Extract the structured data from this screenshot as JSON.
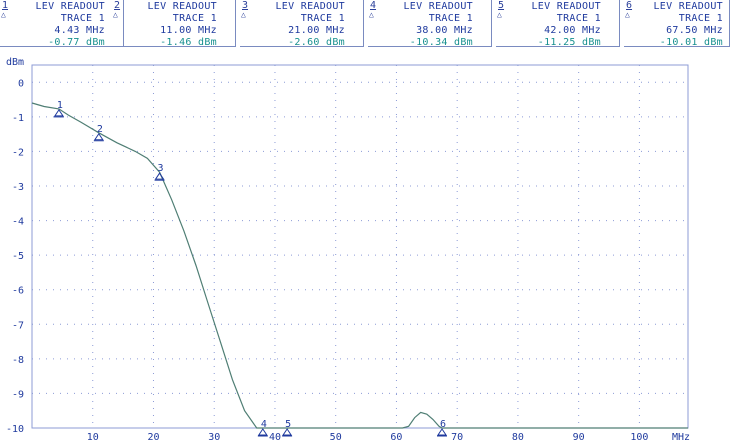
{
  "readouts": [
    {
      "num": "1",
      "title": "LEV READOUT",
      "trace": "TRACE 1",
      "freq": "4.43 MHz",
      "level": "-0.77 dBm"
    },
    {
      "num": "2",
      "title": "LEV READOUT",
      "trace": "TRACE 1",
      "freq": "11.00 MHz",
      "level": "-1.46 dBm"
    },
    {
      "num": "3",
      "title": "LEV READOUT",
      "trace": "TRACE 1",
      "freq": "21.00 MHz",
      "level": "-2.60 dBm"
    },
    {
      "num": "4",
      "title": "LEV READOUT",
      "trace": "TRACE 1",
      "freq": "38.00 MHz",
      "level": "-10.34 dBm"
    },
    {
      "num": "5",
      "title": "LEV READOUT",
      "trace": "TRACE 1",
      "freq": "42.00 MHz",
      "level": "-11.25 dBm"
    },
    {
      "num": "6",
      "title": "LEV READOUT",
      "trace": "TRACE 1",
      "freq": "67.50 MHz",
      "level": "-10.01 dBm"
    }
  ],
  "chart_data": {
    "type": "line",
    "ylabel": "dBm",
    "xunit": "MHz",
    "xlim": [
      0,
      108
    ],
    "ylim": [
      -10,
      0.5
    ],
    "x_ticks": [
      10,
      20,
      30,
      40,
      50,
      60,
      70,
      80,
      90,
      100
    ],
    "x_tick_labels": [
      "10",
      "20",
      "30",
      "40",
      "50",
      "60",
      "70",
      "80",
      "90",
      "100"
    ],
    "y_ticks": [
      0,
      -1,
      -2,
      -3,
      -4,
      -5,
      -6,
      -7,
      -8,
      -9,
      -10
    ],
    "y_tick_labels": [
      "0",
      "-1",
      "-2",
      "-3",
      "-4",
      "-5",
      "-6",
      "-7",
      "-8",
      "-9",
      "-10"
    ],
    "grid": true,
    "colors": {
      "trace": "#4f7e74",
      "grid": "#8c9bd6",
      "text": "#1f3a9e",
      "level": "#17908f"
    },
    "series": [
      {
        "x": [
          0,
          2,
          4.43,
          6,
          8,
          11,
          14,
          17,
          19,
          21,
          23,
          25,
          27,
          29,
          31,
          33,
          35,
          37,
          38,
          42,
          50,
          60,
          61,
          62,
          63,
          64,
          65,
          66,
          67,
          67.5,
          70,
          80,
          90,
          100,
          108
        ],
        "y": [
          -0.6,
          -0.7,
          -0.77,
          -0.95,
          -1.15,
          -1.46,
          -1.75,
          -2.0,
          -2.2,
          -2.6,
          -3.4,
          -4.3,
          -5.3,
          -6.4,
          -7.5,
          -8.6,
          -9.5,
          -10,
          -10,
          -10,
          -10,
          -10,
          -10,
          -9.95,
          -9.7,
          -9.55,
          -9.6,
          -9.75,
          -9.95,
          -10,
          -10,
          -10,
          -10,
          -10,
          -10
        ]
      }
    ],
    "markers": [
      {
        "label": "1",
        "x": 4.43,
        "y": -0.77
      },
      {
        "label": "2",
        "x": 11.0,
        "y": -1.46
      },
      {
        "label": "3",
        "x": 21.0,
        "y": -2.6
      },
      {
        "label": "4",
        "x": 38.0,
        "y": -10
      },
      {
        "label": "5",
        "x": 42.0,
        "y": -10
      },
      {
        "label": "6",
        "x": 67.5,
        "y": -10
      }
    ]
  }
}
